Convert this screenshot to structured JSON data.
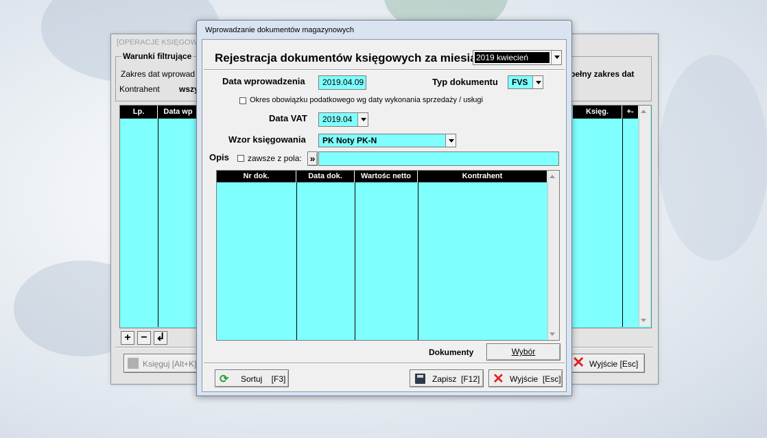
{
  "background_window": {
    "title": "[OPERACJE KSIĘGOWE",
    "filter_group_title": "Warunki filtrujące",
    "date_range_label": "Zakres dat  wprowad",
    "full_range_label": "pełny zakres dat",
    "contractor_label": "Kontrahent",
    "contractor_value": "wszy",
    "columns": [
      "Lp.",
      "Data wp",
      "Księg.",
      "+-"
    ],
    "book_button": "Księguj [Alt+K]",
    "exit_button": "Wyjście  [Esc]"
  },
  "dialog": {
    "title": "Wprowadzanie dokumentów magazynowych",
    "heading": "Rejestracja dokumentów księgowych za miesiąc",
    "month_value": "2019 kwiecień",
    "entry_date_label": "Data wprowadzenia",
    "entry_date_value": "2019.04.09",
    "doc_type_label": "Typ dokumentu",
    "doc_type_value": "FVS",
    "tax_period_checkbox": "Okres obowiązku podatkowego wg daty wykonania sprzedaży / usługi",
    "vat_date_label": "Data VAT",
    "vat_date_value": "2019.04",
    "posting_pattern_label": "Wzor księgowania",
    "posting_pattern_value": "PK  Noty PK-N",
    "desc_label": "Opis",
    "always_from_field": "zawsze z pola:",
    "desc_button": "»",
    "desc_value": "",
    "table_columns": [
      "Nr dok.",
      "Data dok.",
      "Wartośc netto",
      "Kontrahent"
    ],
    "documents_label": "Dokumenty",
    "select_button": "Wybór",
    "sort_button": "Sortuj    [F3]",
    "save_button": "Zapisz  [F12]",
    "exit_button": "Wyjście  [Esc]"
  },
  "colors": {
    "field": "#80ffff",
    "header": "#000000",
    "accent_red": "#e02020"
  }
}
